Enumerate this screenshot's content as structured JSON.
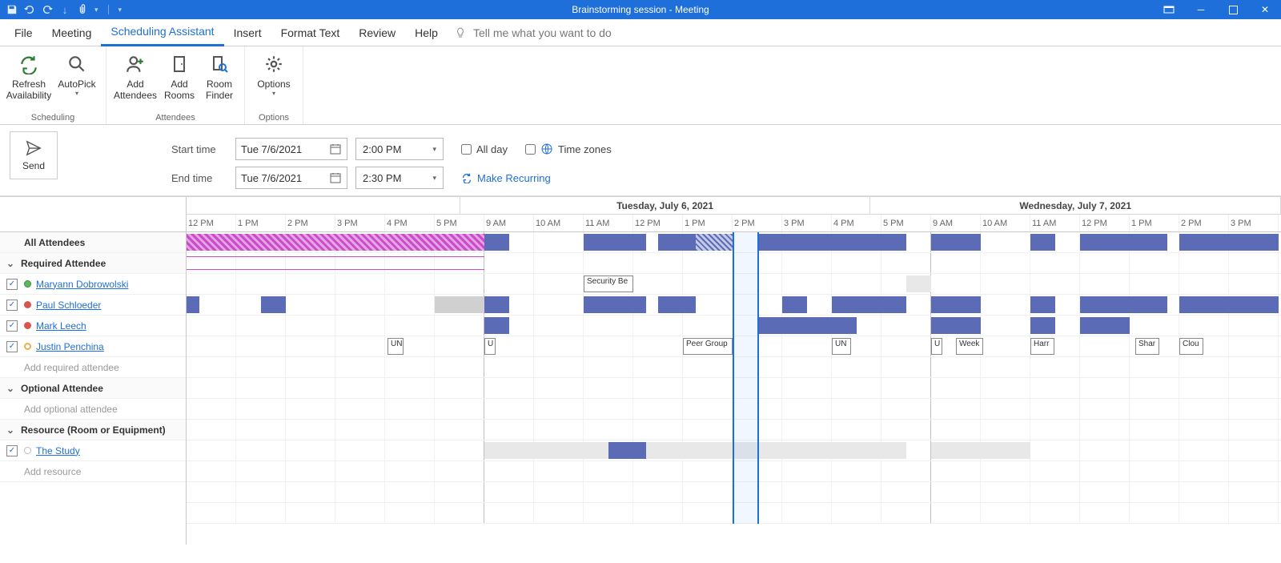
{
  "window": {
    "title": "Brainstorming session  -  Meeting"
  },
  "tabs": {
    "file": "File",
    "meeting": "Meeting",
    "scheduling_assistant": "Scheduling Assistant",
    "insert": "Insert",
    "format_text": "Format Text",
    "review": "Review",
    "help": "Help",
    "tell_me": "Tell me what you want to do"
  },
  "ribbon": {
    "scheduling_group": "Scheduling",
    "attendees_group": "Attendees",
    "options_group": "Options",
    "refresh": "Refresh Availability",
    "autopick": "AutoPick",
    "add_attendees": "Add Attendees",
    "add_rooms": "Add Rooms",
    "room_finder": "Room Finder",
    "options": "Options"
  },
  "form": {
    "send": "Send",
    "start_time": "Start time",
    "end_time": "End time",
    "start_date": "Tue 7/6/2021",
    "end_date": "Tue 7/6/2021",
    "start_hour": "2:00 PM",
    "end_hour": "2:30 PM",
    "all_day": "All day",
    "time_zones": "Time zones",
    "make_recurring": "Make Recurring"
  },
  "days": {
    "tuesday": "Tuesday, July 6, 2021",
    "wednesday": "Wednesday, July 7, 2021"
  },
  "time_slots": [
    "12 PM",
    "1 PM",
    "2 PM",
    "3 PM",
    "4 PM",
    "5 PM",
    "9 AM",
    "10 AM",
    "11 AM",
    "12 PM",
    "1 PM",
    "2 PM",
    "3 PM",
    "4 PM",
    "5 PM",
    "9 AM",
    "10 AM",
    "11 AM",
    "12 PM",
    "1 PM",
    "2 PM",
    "3 PM"
  ],
  "attendees": {
    "all": "All Attendees",
    "required": "Required Attendee",
    "optional": "Optional Attendee",
    "resource": "Resource (Room or Equipment)",
    "add_required": "Add required attendee",
    "add_optional": "Add optional attendee",
    "add_resource": "Add resource",
    "list": [
      {
        "name": "Maryann Dobrowolski",
        "status": "#5cb85c"
      },
      {
        "name": "Paul Schloeder",
        "status": "#d9534f"
      },
      {
        "name": "Mark Leech",
        "status": "#d9534f"
      },
      {
        "name": "Justin Penchina",
        "status": "#f0ad4e"
      }
    ],
    "rooms": [
      {
        "name": "The Study",
        "status": "#ddd"
      }
    ]
  },
  "events": {
    "security": "Security Be",
    "peer": "Peer Group",
    "un": "UN",
    "u": "U",
    "week": "Week",
    "harr": "Harr",
    "shar": "Shar",
    "clou": "Clou"
  }
}
